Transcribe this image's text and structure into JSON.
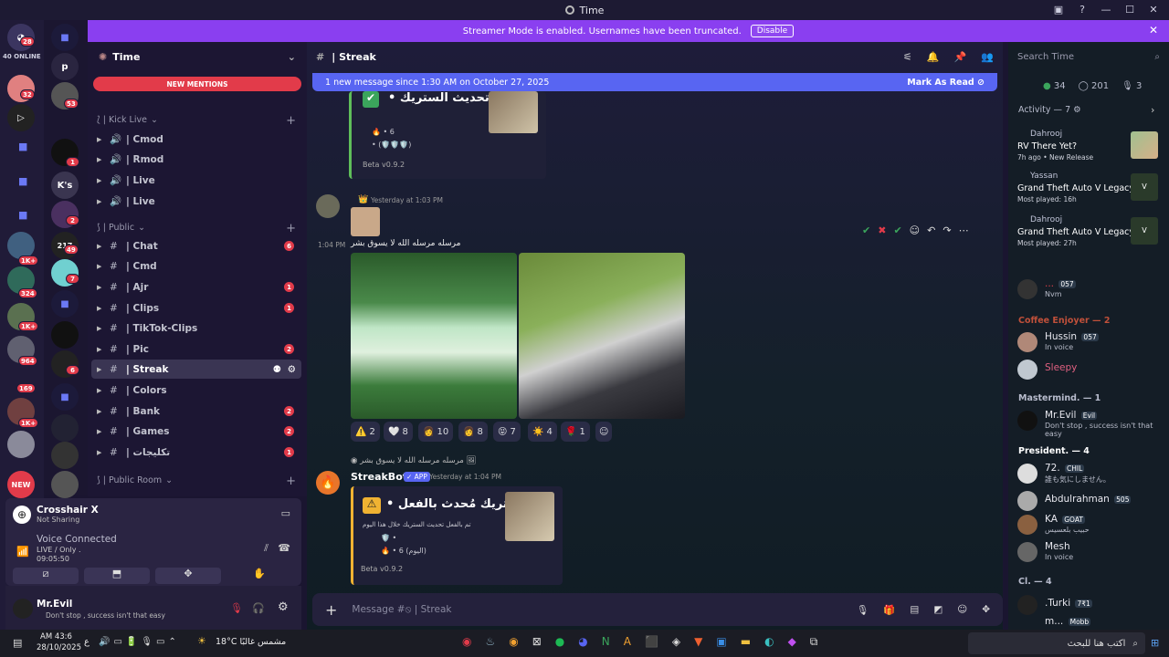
{
  "window": {
    "title": "Time"
  },
  "banner": {
    "text": "Streamer Mode is enabled. Usernames have been truncated.",
    "button": "Disable"
  },
  "rail": {
    "online": "40 ONLINE",
    "home_badge": "28",
    "badges": [
      "32",
      "53",
      "1",
      "2",
      "49",
      "7",
      "1K+",
      "324",
      "1K+",
      "964",
      "6",
      "169",
      "1K+"
    ],
    "new_label": "NEW",
    "ks_label": "K's",
    "p_label": "p"
  },
  "server": {
    "name": "Time",
    "new_mentions": "NEW MENTIONS"
  },
  "categories": {
    "kick": "⟅ | Kick Live",
    "public": "⟆ | Public",
    "publicroom": "⟆ | Public Room"
  },
  "channels": {
    "voice": [
      {
        "label": "| Cmod"
      },
      {
        "label": "| Rmod"
      },
      {
        "label": "| Live"
      },
      {
        "label": "| Live"
      }
    ],
    "text": [
      {
        "label": "| Chat",
        "badge": "6"
      },
      {
        "label": "| Cmd",
        "badge": ""
      },
      {
        "label": "| Ajr",
        "badge": "1"
      },
      {
        "label": "| Clips",
        "badge": "1"
      },
      {
        "label": "| TikTok-Clips",
        "badge": ""
      },
      {
        "label": "| Pic",
        "badge": "2"
      },
      {
        "label": "| Streak",
        "badge": ""
      },
      {
        "label": "| Colors",
        "badge": ""
      },
      {
        "label": "| Bank",
        "badge": "2"
      },
      {
        "label": "| Games",
        "badge": "2"
      },
      {
        "label": "| تكليجات",
        "badge": "1"
      }
    ]
  },
  "voice": {
    "title": "Crosshair X",
    "subtitle": "Not Sharing",
    "status": "Voice Connected",
    "channel": "LIVE / Only .",
    "timer": "09:05:50"
  },
  "user": {
    "name": "Mr.Evil",
    "status": "Don't stop , success isn't that easy"
  },
  "chat": {
    "channel": "| Streak",
    "new_messages": "1 new message since 1:30 AM on October 27, 2025",
    "mark_read": "Mark As Read",
    "embed1": {
      "title": "تم تحديث الستريك •",
      "fire_count": "6",
      "shields": "• (🛡️🛡️🛡️)",
      "version": "Beta v0.9.2"
    },
    "msg2": {
      "time": "Yesterday at 1:03 PM",
      "side_time": "1:04 PM",
      "text": "مرسله مرسله الله لا يسوق بشر"
    },
    "reactions": [
      {
        "e": "⚠️",
        "n": "2"
      },
      {
        "e": "🤍",
        "n": "8"
      },
      {
        "e": "👩",
        "n": "10"
      },
      {
        "e": "👩",
        "n": "8"
      },
      {
        "e": "😝",
        "n": "7"
      },
      {
        "e": "☀️",
        "n": "4"
      },
      {
        "e": "🌹",
        "n": "1"
      }
    ],
    "msg3": {
      "reply": "مرسله مرسله الله لا يسوق بشر",
      "author": "StreakBot",
      "app": "APP",
      "time": "Yesterday at 1:04 PM"
    },
    "embed2": {
      "title": "الستريك مُحدث بالفعل •",
      "desc": "تم بالفعل تحديث الستريك خلال هذا اليوم",
      "shield": "🛡️ •",
      "fire": "• 6 (اليوم)",
      "version": "Beta v0.9.2"
    },
    "composer_placeholder": "Message #⦸ | Streak"
  },
  "members": {
    "search_placeholder": "Search Time",
    "stats": {
      "online": "34",
      "idle": "201",
      "voice": "3"
    },
    "activity_header": "Activity — 7",
    "activities": [
      {
        "who": "Dahrooj",
        "what": "RV There Yet?",
        "sub": "7h ago • New Release"
      },
      {
        "who": "Yassan",
        "what": "Grand Theft Auto V Legacy",
        "sub": "Most played: 16h"
      },
      {
        "who": "Dahrooj",
        "what": "Grand Theft Auto V Legacy",
        "sub": "Most played: 27h"
      }
    ],
    "groups": [
      {
        "title": "Coffee Enjoyer — 2",
        "items": [
          {
            "name": "Hussin",
            "tag": "057",
            "status": "In voice"
          },
          {
            "name": "Sleepy",
            "tag": "",
            "status": ""
          }
        ]
      },
      {
        "title": "Mastermind. — 1",
        "items": [
          {
            "name": "Mr.Evil",
            "tag": "Evil",
            "status": "Don't stop , success isn't that easy"
          }
        ]
      },
      {
        "title": "President. — 4",
        "items": [
          {
            "name": "72.",
            "tag": "CHIL",
            "status": "誰も気にしません。"
          },
          {
            "name": "Abdulrahman",
            "tag": "505",
            "status": ""
          },
          {
            "name": "KA",
            "tag": "GOAT",
            "status": "حبيب بلعسيس"
          },
          {
            "name": "Mesh",
            "tag": "",
            "status": "In voice"
          }
        ]
      },
      {
        "title": "Cl. — 4",
        "items": [
          {
            "name": ".Turki",
            "tag": "7₹1",
            "status": ""
          },
          {
            "name": "m...",
            "tag": "Mobb",
            "status": ""
          }
        ]
      }
    ],
    "top_member": {
      "name": "...",
      "tag": "057",
      "status": "Nvm"
    }
  },
  "taskbar": {
    "time": "AM 43:6",
    "date": "28/10/2025",
    "weather": "18°C مشمس غالبًا",
    "search": "اكتب هنا للبحث",
    "lang": "ع"
  }
}
